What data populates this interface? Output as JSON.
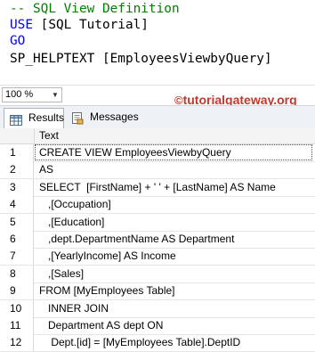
{
  "editor": {
    "lines": [
      [
        {
          "t": "-- SQL View Definition",
          "c": "comment"
        }
      ],
      [
        {
          "t": "USE",
          "c": "keyword"
        },
        {
          "t": " [SQL Tutorial]",
          "c": "plain"
        }
      ],
      [
        {
          "t": "GO",
          "c": "keyword"
        }
      ],
      [
        {
          "t": "SP_HELPTEXT",
          "c": "plain"
        },
        {
          "t": " [EmployeesViewbyQuery]",
          "c": "plain"
        }
      ]
    ],
    "colors": {
      "comment": "#008000",
      "keyword": "#0000ff",
      "plain": "#000000"
    }
  },
  "zoom": {
    "value": "100 %"
  },
  "watermark": {
    "symbol": "©",
    "text": "tutorialgateway.org"
  },
  "tabs": [
    {
      "label": "Results",
      "icon": "grid-icon",
      "active": true
    },
    {
      "label": "Messages",
      "icon": "messages-icon",
      "active": false
    }
  ],
  "grid": {
    "column_header": "Text",
    "rows": [
      {
        "num": "1",
        "text": "CREATE VIEW EmployeesViewbyQuery"
      },
      {
        "num": "2",
        "text": "AS"
      },
      {
        "num": "3",
        "text": "SELECT  [FirstName] + ' ' + [LastName] AS Name"
      },
      {
        "num": "4",
        "text": "   ,[Occupation]"
      },
      {
        "num": "5",
        "text": "   ,[Education]"
      },
      {
        "num": "6",
        "text": "   ,dept.DepartmentName AS Department"
      },
      {
        "num": "7",
        "text": "   ,[YearlyIncome] AS Income"
      },
      {
        "num": "8",
        "text": "   ,[Sales]"
      },
      {
        "num": "9",
        "text": "FROM [MyEmployees Table]"
      },
      {
        "num": "10",
        "text": "   INNER JOIN"
      },
      {
        "num": "11",
        "text": "   Department AS dept ON"
      },
      {
        "num": "12",
        "text": "    Dept.[id] = [MyEmployees Table].DeptID"
      }
    ]
  }
}
